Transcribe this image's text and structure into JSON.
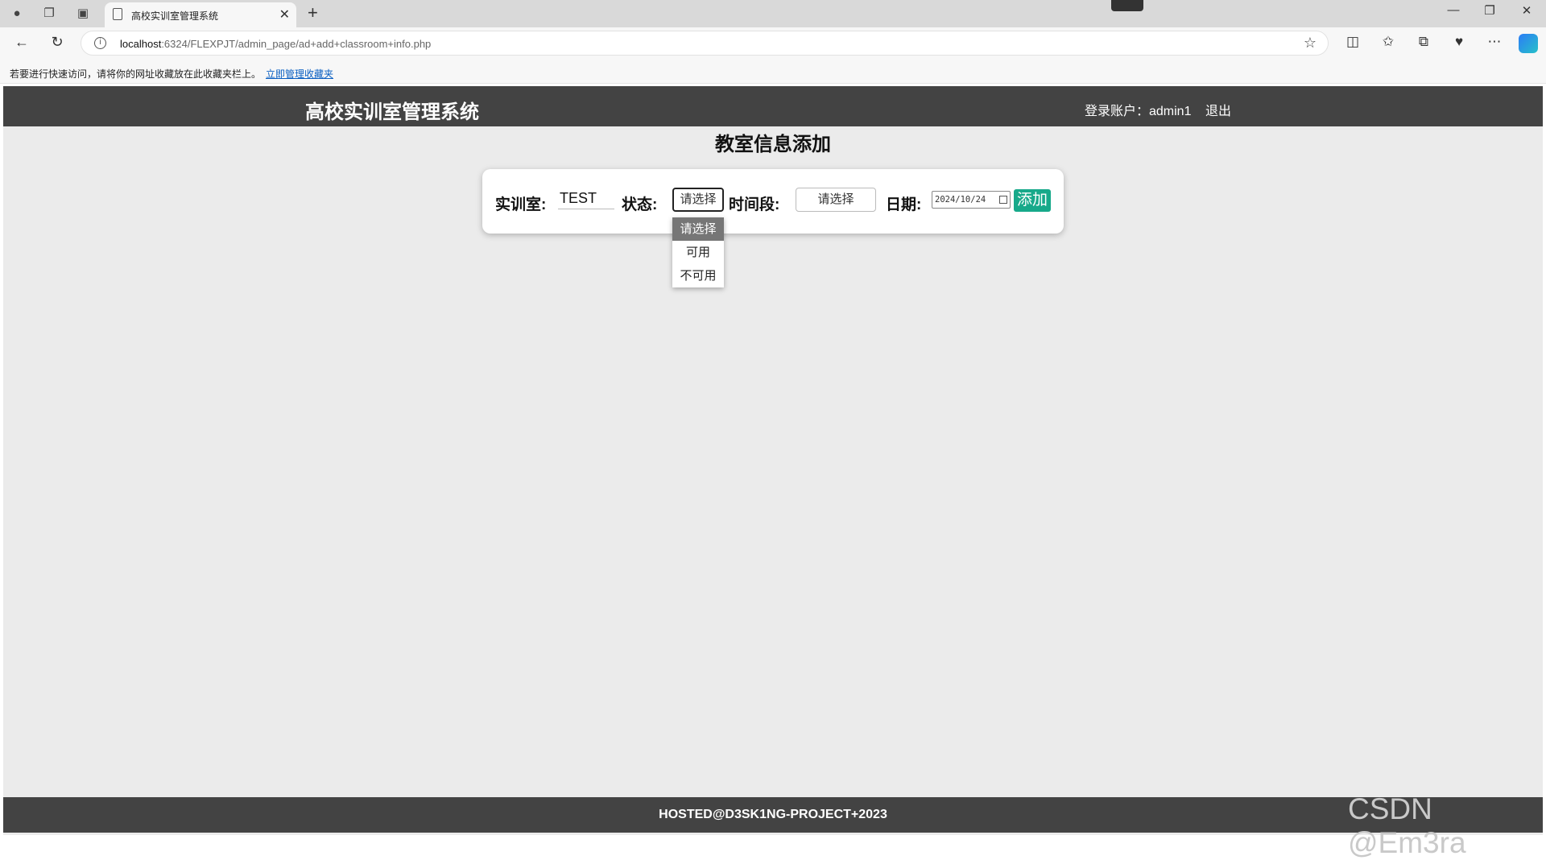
{
  "browser": {
    "tab_title": "高校实训室管理系统",
    "url_host": "localhost",
    "url_rest": ":6324/FLEXPJT/admin_page/ad+add+classroom+info.php",
    "favorites_hint": "若要进行快速访问，请将你的网址收藏放在此收藏夹栏上。",
    "favorites_link": "立即管理收藏夹"
  },
  "header": {
    "site_title": "高校实训室管理系统",
    "user_label": "登录账户：admin1",
    "logout": "退出"
  },
  "main": {
    "heading": "教室信息添加",
    "form": {
      "room_label": "实训室:",
      "room_value": "TEST",
      "status_label": "状态:",
      "status_value": "请选择",
      "time_label": "时间段:",
      "time_value": "请选择",
      "date_label": "日期:",
      "date_value": "2024/10/24",
      "add_button": "添加"
    },
    "status_options": [
      "请选择",
      "可用",
      "不可用"
    ]
  },
  "footer": {
    "text": "HOSTED@D3SK1NG-PROJECT+2023"
  },
  "watermark": "CSDN @Em3ra",
  "colors": {
    "header_bg": "#434343",
    "page_bg": "#ebebeb",
    "accent": "#17a98a"
  }
}
